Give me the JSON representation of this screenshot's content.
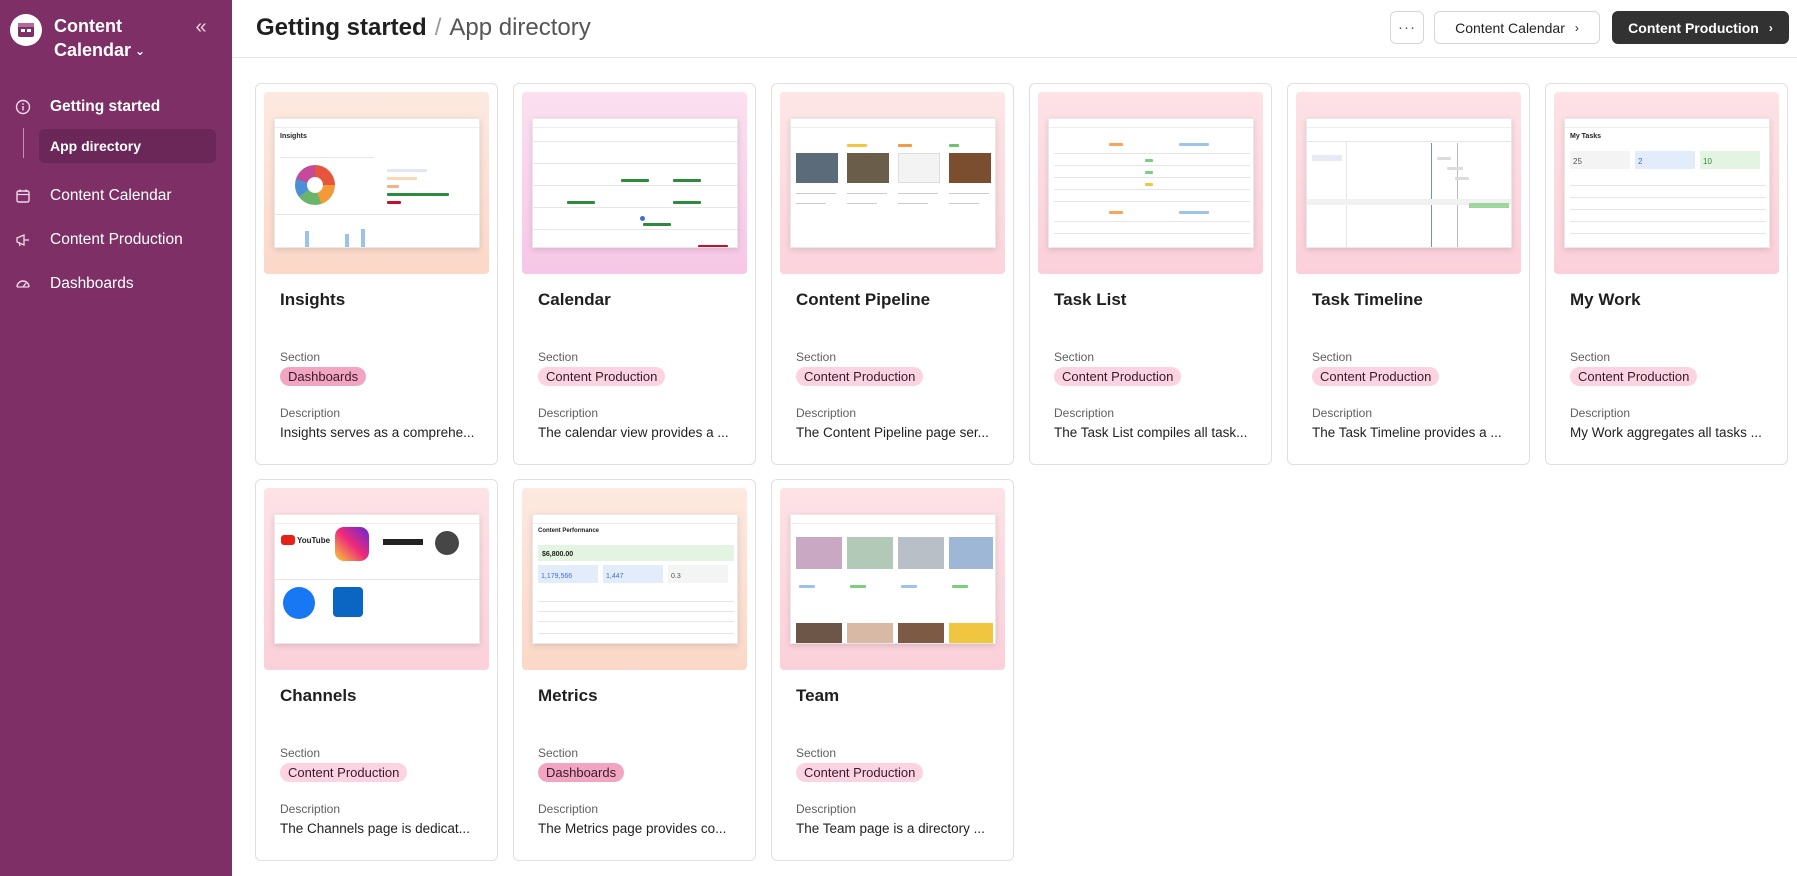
{
  "sidebar": {
    "workspace_title": "Content Calendar",
    "items": [
      {
        "label": "Getting started",
        "icon": "info-circle-icon"
      },
      {
        "label": "Content Calendar",
        "icon": "calendar-icon"
      },
      {
        "label": "Content Production",
        "icon": "megaphone-icon"
      },
      {
        "label": "Dashboards",
        "icon": "gauge-icon"
      }
    ],
    "sub_item": "App directory"
  },
  "header": {
    "crumb1": "Getting started",
    "separator": "/",
    "crumb2": "App directory",
    "more": "···",
    "btn_calendar": "Content Calendar",
    "btn_production": "Content Production"
  },
  "labels": {
    "section": "Section",
    "description": "Description"
  },
  "cards": [
    {
      "title": "Insights",
      "section": "Dashboards",
      "description": "Insights serves as a comprehe...",
      "thumb_color": "#fde3d6"
    },
    {
      "title": "Calendar",
      "section": "Content Production",
      "description": "The calendar view provides a ...",
      "thumb_color": "#f9d2ea"
    },
    {
      "title": "Content Pipeline",
      "section": "Content Production",
      "description": "The Content Pipeline page ser...",
      "thumb_color": "#fbdde4"
    },
    {
      "title": "Task List",
      "section": "Content Production",
      "description": "The Task List compiles all task...",
      "thumb_color": "#fbd6dd"
    },
    {
      "title": "Task Timeline",
      "section": "Content Production",
      "description": "The Task Timeline provides a ...",
      "thumb_color": "#fbd6dd"
    },
    {
      "title": "My Work",
      "section": "Content Production",
      "description": "My Work aggregates all tasks ...",
      "thumb_color": "#fbd6dd"
    },
    {
      "title": "Channels",
      "section": "Content Production",
      "description": "The Channels page is dedicat...",
      "thumb_color": "#fbd6dd"
    },
    {
      "title": "Metrics",
      "section": "Dashboards",
      "description": "The Metrics page provides co...",
      "thumb_color": "#fde3d6"
    },
    {
      "title": "Team",
      "section": "Content Production",
      "description": "The Team page is a directory ...",
      "thumb_color": "#fbd6dd"
    }
  ],
  "thumbs": {
    "insights": {
      "heading": "Insights"
    },
    "metrics": {
      "heading": "Content Performance",
      "value_main": "$6,800.00",
      "stat1": "1,179,566",
      "stat2": "1,447",
      "stat3": "0.3"
    },
    "mywork": {
      "heading": "My Tasks",
      "stat1": "25",
      "stat2": "2",
      "stat3": "10"
    },
    "channels": {
      "youtube": "YouTube"
    }
  }
}
